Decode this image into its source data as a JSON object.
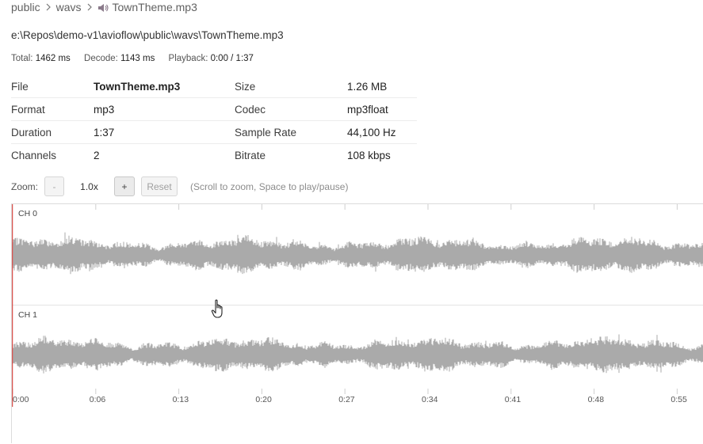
{
  "breadcrumb": {
    "items": [
      {
        "label": "public"
      },
      {
        "label": "wavs"
      },
      {
        "label": "TownTheme.mp3",
        "icon": "speaker-icon"
      }
    ],
    "separator": ">"
  },
  "file_path": "e:\\Repos\\demo-v1\\avioflow\\public\\wavs\\TownTheme.mp3",
  "timing": {
    "total_label": "Total:",
    "total_value": "1462 ms",
    "decode_label": "Decode:",
    "decode_value": "1143 ms",
    "playback_label": "Playback:",
    "playback_value": "0:00 / 1:37"
  },
  "info": {
    "rows": [
      {
        "key1": "File",
        "val1": "TownTheme.mp3",
        "key2": "Size",
        "val2": "1.26 MB"
      },
      {
        "key1": "Format",
        "val1": "mp3",
        "key2": "Codec",
        "val2": "mp3float"
      },
      {
        "key1": "Duration",
        "val1": "1:37",
        "key2": "Sample Rate",
        "val2": "44,100 Hz"
      },
      {
        "key1": "Channels",
        "val1": "2",
        "key2": "Bitrate",
        "val2": "108 kbps"
      }
    ]
  },
  "zoom": {
    "label": "Zoom:",
    "minus_label": "-",
    "value": "1.0x",
    "plus_label": "+",
    "reset_label": "Reset",
    "hint": "(Scroll to zoom, Space to play/pause)"
  },
  "waveform": {
    "channels": [
      {
        "label": "CH 0"
      },
      {
        "label": "CH 1"
      }
    ],
    "time_ticks": [
      "0:00",
      "0:06",
      "0:13",
      "0:20",
      "0:27",
      "0:34",
      "0:41",
      "0:48",
      "0:55"
    ],
    "playhead_position": "0:00",
    "wave_color": "#aaaaaa",
    "playhead_color": "#d9534f"
  },
  "colors": {
    "text": "#3a3a3a",
    "muted": "#8c8c8c",
    "border": "#dcdcdc"
  }
}
